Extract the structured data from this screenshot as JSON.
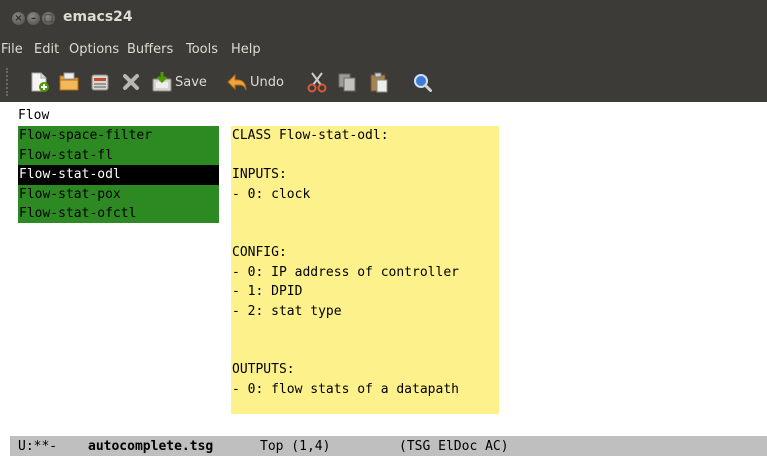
{
  "window": {
    "title": "emacs24",
    "controls": {
      "close_glyph": "×",
      "minimize_glyph": "–",
      "maximize_glyph": "□"
    }
  },
  "menubar": {
    "items": [
      "File",
      "Edit",
      "Options",
      "Buffers",
      "Tools",
      "Help"
    ]
  },
  "toolbar": {
    "buttons": [
      {
        "icon": "new-file-icon"
      },
      {
        "icon": "open-folder-icon"
      },
      {
        "icon": "kill-buffer-icon"
      },
      {
        "icon": "close-x-icon"
      },
      {
        "icon": "save-icon",
        "label": "Save"
      },
      {
        "icon": "undo-icon",
        "label": "Undo"
      },
      {
        "icon": "cut-icon"
      },
      {
        "icon": "copy-icon"
      },
      {
        "icon": "paste-icon"
      },
      {
        "icon": "search-icon"
      }
    ]
  },
  "editor": {
    "buffer_text": "Flow",
    "completions": [
      {
        "label": "Flow-space-filter",
        "selected": false
      },
      {
        "label": "Flow-stat-fl",
        "selected": false
      },
      {
        "label": "Flow-stat-odl",
        "selected": true
      },
      {
        "label": "Flow-stat-pox",
        "selected": false
      },
      {
        "label": "Flow-stat-ofctl",
        "selected": false
      }
    ],
    "doc_popup": {
      "lines": [
        "CLASS Flow-stat-odl:",
        "",
        "INPUTS:",
        "- 0: clock",
        "",
        "",
        "CONFIG:",
        "- 0: IP address of controller",
        "- 1: DPID",
        "- 2: stat type",
        "",
        "",
        "OUTPUTS:",
        "- 0: flow stats of a datapath"
      ]
    }
  },
  "modeline": {
    "status": "U:**-",
    "buffer_name": "autocomplete.tsg",
    "position": "Top (1,4)",
    "modes": "(TSG ElDoc AC)"
  },
  "colors": {
    "chrome_bg": "#3c3b37",
    "completion_bg": "#2d8a22",
    "selection_bg": "#000000",
    "doc_bg": "#fdf18c",
    "modeline_bg": "#bfbfbf"
  }
}
